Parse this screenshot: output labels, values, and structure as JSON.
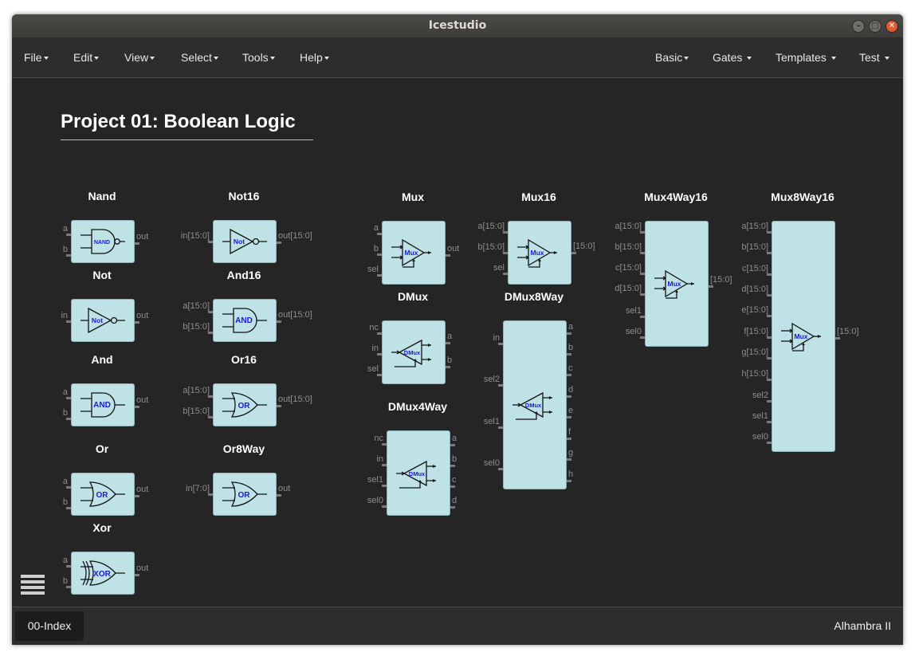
{
  "window": {
    "title": "Icestudio"
  },
  "menus_left": [
    {
      "label": "File"
    },
    {
      "label": "Edit"
    },
    {
      "label": "View"
    },
    {
      "label": "Select"
    },
    {
      "label": "Tools"
    },
    {
      "label": "Help"
    }
  ],
  "menus_right": [
    {
      "label": "Basic"
    },
    {
      "label": "Gates"
    },
    {
      "label": "Templates"
    },
    {
      "label": "Test"
    }
  ],
  "project": {
    "title": "Project 01: Boolean Logic"
  },
  "blocks": {
    "nand": {
      "title": "Nand",
      "gate": "NAND",
      "in": [
        "a",
        "b"
      ],
      "out": [
        "out"
      ]
    },
    "not": {
      "title": "Not",
      "gate": "Not",
      "in": [
        "in"
      ],
      "out": [
        "out"
      ]
    },
    "and": {
      "title": "And",
      "gate": "AND",
      "in": [
        "a",
        "b"
      ],
      "out": [
        "out"
      ]
    },
    "or": {
      "title": "Or",
      "gate": "OR",
      "in": [
        "a",
        "b"
      ],
      "out": [
        "out"
      ]
    },
    "xor": {
      "title": "Xor",
      "gate": "XOR",
      "in": [
        "a",
        "b"
      ],
      "out": [
        "out"
      ]
    },
    "not16": {
      "title": "Not16",
      "gate": "Not",
      "in": [
        "in[15:0]"
      ],
      "out": [
        "out[15:0]"
      ]
    },
    "and16": {
      "title": "And16",
      "gate": "AND",
      "in": [
        "a[15:0]",
        "b[15:0]"
      ],
      "out": [
        "out[15:0]"
      ]
    },
    "or16": {
      "title": "Or16",
      "gate": "OR",
      "in": [
        "a[15:0]",
        "b[15:0]"
      ],
      "out": [
        "out[15:0]"
      ]
    },
    "or8way": {
      "title": "Or8Way",
      "gate": "OR",
      "in": [
        "in[7:0]"
      ],
      "out": [
        "out"
      ]
    },
    "mux": {
      "title": "Mux",
      "gate": "Mux",
      "in": [
        "a",
        "b",
        "sel"
      ],
      "out": [
        "out"
      ]
    },
    "dmux": {
      "title": "DMux",
      "gate": "DMux",
      "in": [
        "nc",
        "in",
        "sel"
      ],
      "out": [
        "a",
        "b"
      ]
    },
    "dmux4way": {
      "title": "DMux4Way",
      "gate": "DMux",
      "in": [
        "nc",
        "in",
        "sel1",
        "sel0"
      ],
      "out": [
        "a",
        "b",
        "c",
        "d"
      ]
    },
    "mux16": {
      "title": "Mux16",
      "gate": "Mux",
      "in": [
        "a[15:0]",
        "b[15:0]",
        "sel"
      ],
      "out": [
        "[15:0]"
      ]
    },
    "dmux8way": {
      "title": "DMux8Way",
      "gate": "DMux",
      "in": [
        "in",
        "sel2",
        "sel1",
        "sel0"
      ],
      "out": [
        "a",
        "b",
        "c",
        "d",
        "e",
        "f",
        "g",
        "h"
      ]
    },
    "mux4way16": {
      "title": "Mux4Way16",
      "gate": "Mux",
      "in": [
        "a[15:0]",
        "b[15:0]",
        "c[15:0]",
        "d[15:0]",
        "sel1",
        "sel0"
      ],
      "out": [
        "[15:0]"
      ]
    },
    "mux8way16": {
      "title": "Mux8Way16",
      "gate": "Mux",
      "in": [
        "a[15:0]",
        "b[15:0]",
        "c[15:0]",
        "d[15:0]",
        "e[15:0]",
        "f[15:0]",
        "g[15:0]",
        "h[15:0]",
        "sel2",
        "sel1",
        "sel0"
      ],
      "out": [
        "[15:0]"
      ]
    }
  },
  "footer": {
    "tab": "00-Index",
    "board": "Alhambra II"
  },
  "icons": [
    "caret-down-icon",
    "minimize-icon",
    "maximize-icon",
    "close-icon",
    "hamburger-menu-icon",
    "mouse-cursor-icon"
  ]
}
